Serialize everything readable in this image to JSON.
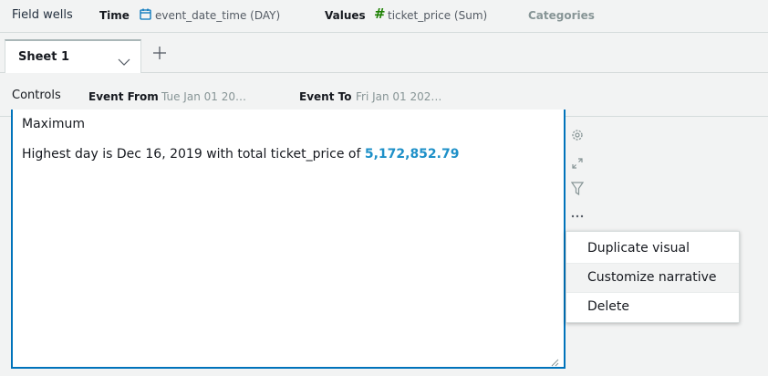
{
  "field_wells": {
    "title": "Field wells",
    "time_label": "Time",
    "time_value": "event_date_time (DAY)",
    "values_label": "Values",
    "values_value": "ticket_price (Sum)",
    "categories_label": "Categories"
  },
  "tabs": {
    "sheets": [
      {
        "label": "Sheet 1"
      }
    ]
  },
  "controls": {
    "title": "Controls",
    "event_from_label": "Event From",
    "event_from_value": "Tue Jan 01 20…",
    "event_to_label": "Event To",
    "event_to_value": "Fri Jan 01 202…"
  },
  "visual": {
    "title": "Maximum",
    "narrative_prefix": "Highest day is Dec 16, 2019 with total ticket_price of ",
    "narrative_value": "5,172,852.79"
  },
  "context_menu": {
    "items": [
      {
        "label": "Duplicate visual"
      },
      {
        "label": "Customize narrative"
      },
      {
        "label": "Delete"
      }
    ]
  },
  "colors": {
    "accent": "#0073bb",
    "value_highlight": "#1e90c8",
    "time_icon": "#0073bb",
    "hash_icon": "#1d8102"
  }
}
